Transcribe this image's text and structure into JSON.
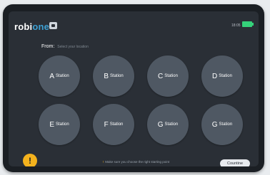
{
  "header": {
    "brand_robi": "robi",
    "brand_one": "one",
    "time": "18:05"
  },
  "form": {
    "from_label": "From:",
    "from_hint": "Select your location"
  },
  "stations": [
    {
      "letter": "A",
      "word": "Station"
    },
    {
      "letter": "B",
      "word": "Station"
    },
    {
      "letter": "C",
      "word": "Station"
    },
    {
      "letter": "D",
      "word": "Station"
    },
    {
      "letter": "E",
      "word": "Station"
    },
    {
      "letter": "F",
      "word": "Station"
    },
    {
      "letter": "G",
      "word": "Station"
    },
    {
      "letter": "G",
      "word": "Station"
    }
  ],
  "footer": {
    "warning_glyph": "!",
    "note": "Make sure you choose the right starting point",
    "continue_label": "Countine",
    "alert_glyph": "!"
  },
  "colors": {
    "background": "#2a2f36",
    "station_fill": "#4f5863",
    "accent_blue": "#3ea0d3",
    "warning_yellow": "#f4b21d",
    "battery_green": "#35d17a"
  },
  "icons": {
    "brand": "app-window-icon",
    "battery": "battery-full-icon",
    "alert": "exclamation-icon"
  }
}
